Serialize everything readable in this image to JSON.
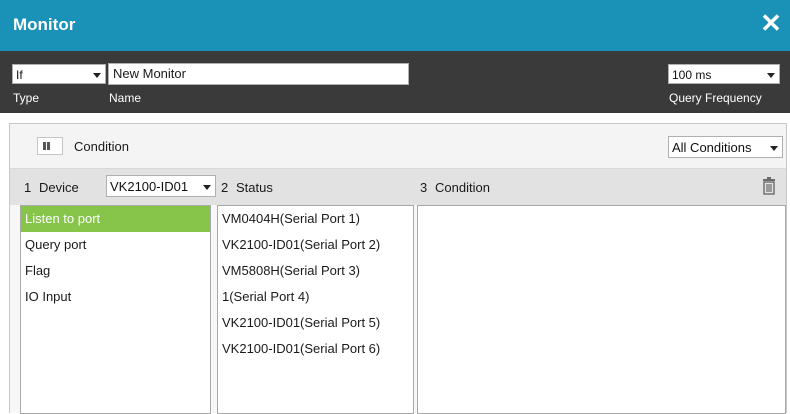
{
  "window": {
    "title": "Monitor",
    "close_icon": "close-icon"
  },
  "topbar": {
    "type": {
      "value": "If",
      "label": "Type"
    },
    "name": {
      "value": "New Monitor",
      "label": "Name"
    },
    "query_frequency": {
      "value": "100 ms",
      "label": "Query Frequency"
    }
  },
  "condition_panel": {
    "toggle_icon": "pause-toggle-icon",
    "label": "Condition",
    "filter": {
      "value": "All Conditions"
    },
    "columns": {
      "device": {
        "number": "1",
        "label": "Device",
        "selected": "VK2100-ID01"
      },
      "status": {
        "number": "2",
        "label": "Status"
      },
      "condition": {
        "number": "3",
        "label": "Condition"
      }
    },
    "delete_icon": "trash-icon",
    "device_items": [
      "Listen to port",
      "Query port",
      "Flag",
      "IO Input"
    ],
    "device_selected_index": 0,
    "status_items": [
      "VM0404H(Serial Port 1)",
      "VK2100-ID01(Serial Port 2)",
      "VM5808H(Serial Port 3)",
      "1(Serial Port 4)",
      "VK2100-ID01(Serial Port 5)",
      "VK2100-ID01(Serial Port 6)"
    ],
    "condition_items": []
  },
  "colors": {
    "titlebar": "#1a92b8",
    "topbar": "#3a3a3a",
    "selection": "#86c54a"
  }
}
